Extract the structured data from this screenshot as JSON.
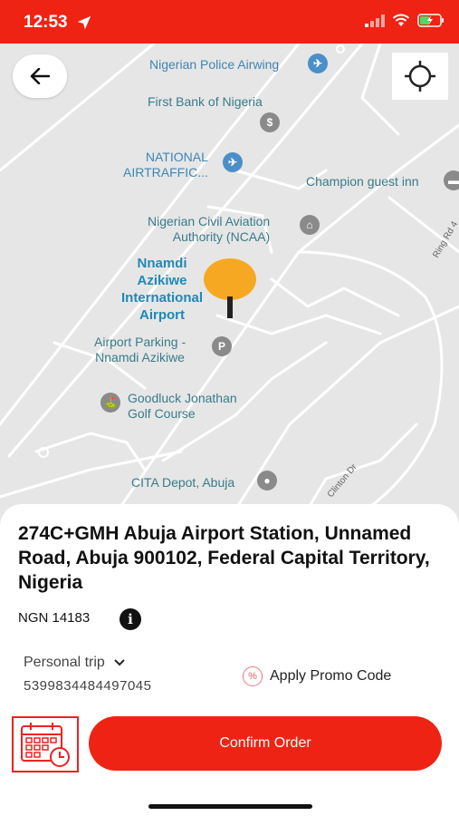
{
  "status_bar": {
    "time": "12:53",
    "icons": [
      "location-arrow-icon",
      "signal-icon",
      "wifi-icon",
      "battery-charging-icon"
    ],
    "accent_color": "#ee2314"
  },
  "map": {
    "pois": {
      "police_airwing": "Nigerian Police Airwing",
      "first_bank": "First Bank of Nigeria",
      "national_airtraffic_line1": "NATIONAL",
      "national_airtraffic_line2": "AIRTRAFFIC...",
      "champion_guest_inn": "Champion guest inn",
      "ncaa_line1": "Nigerian Civil Aviation",
      "ncaa_line2": "Authority (NCAA)",
      "airport_line1": "Nnamdi",
      "airport_line2": "Azikiwe",
      "airport_line3": "International",
      "airport_line4": "Airport",
      "parking_line1": "Airport Parking -",
      "parking_line2": "Nnamdi Azikiwe",
      "golf_line1": "Goodluck Jonathan",
      "golf_line2": "Golf Course",
      "cita_depot": "CITA Depot, Abuja",
      "ring_rd": "Ring Rd 4",
      "clinton_dr": "Clinton Dr"
    },
    "marker_color": "#f7a823"
  },
  "sheet": {
    "address": "274C+GMH Abuja Airport Station, Unnamed Road, Abuja 900102, Federal Capital Territory, Nigeria",
    "price": "NGN 14183",
    "info_glyph": "i",
    "trip_type": "Personal trip",
    "trip_number": "5399834484497045",
    "promo_label": "Apply Promo Code",
    "promo_glyph": "%",
    "confirm_label": "Confirm Order"
  }
}
